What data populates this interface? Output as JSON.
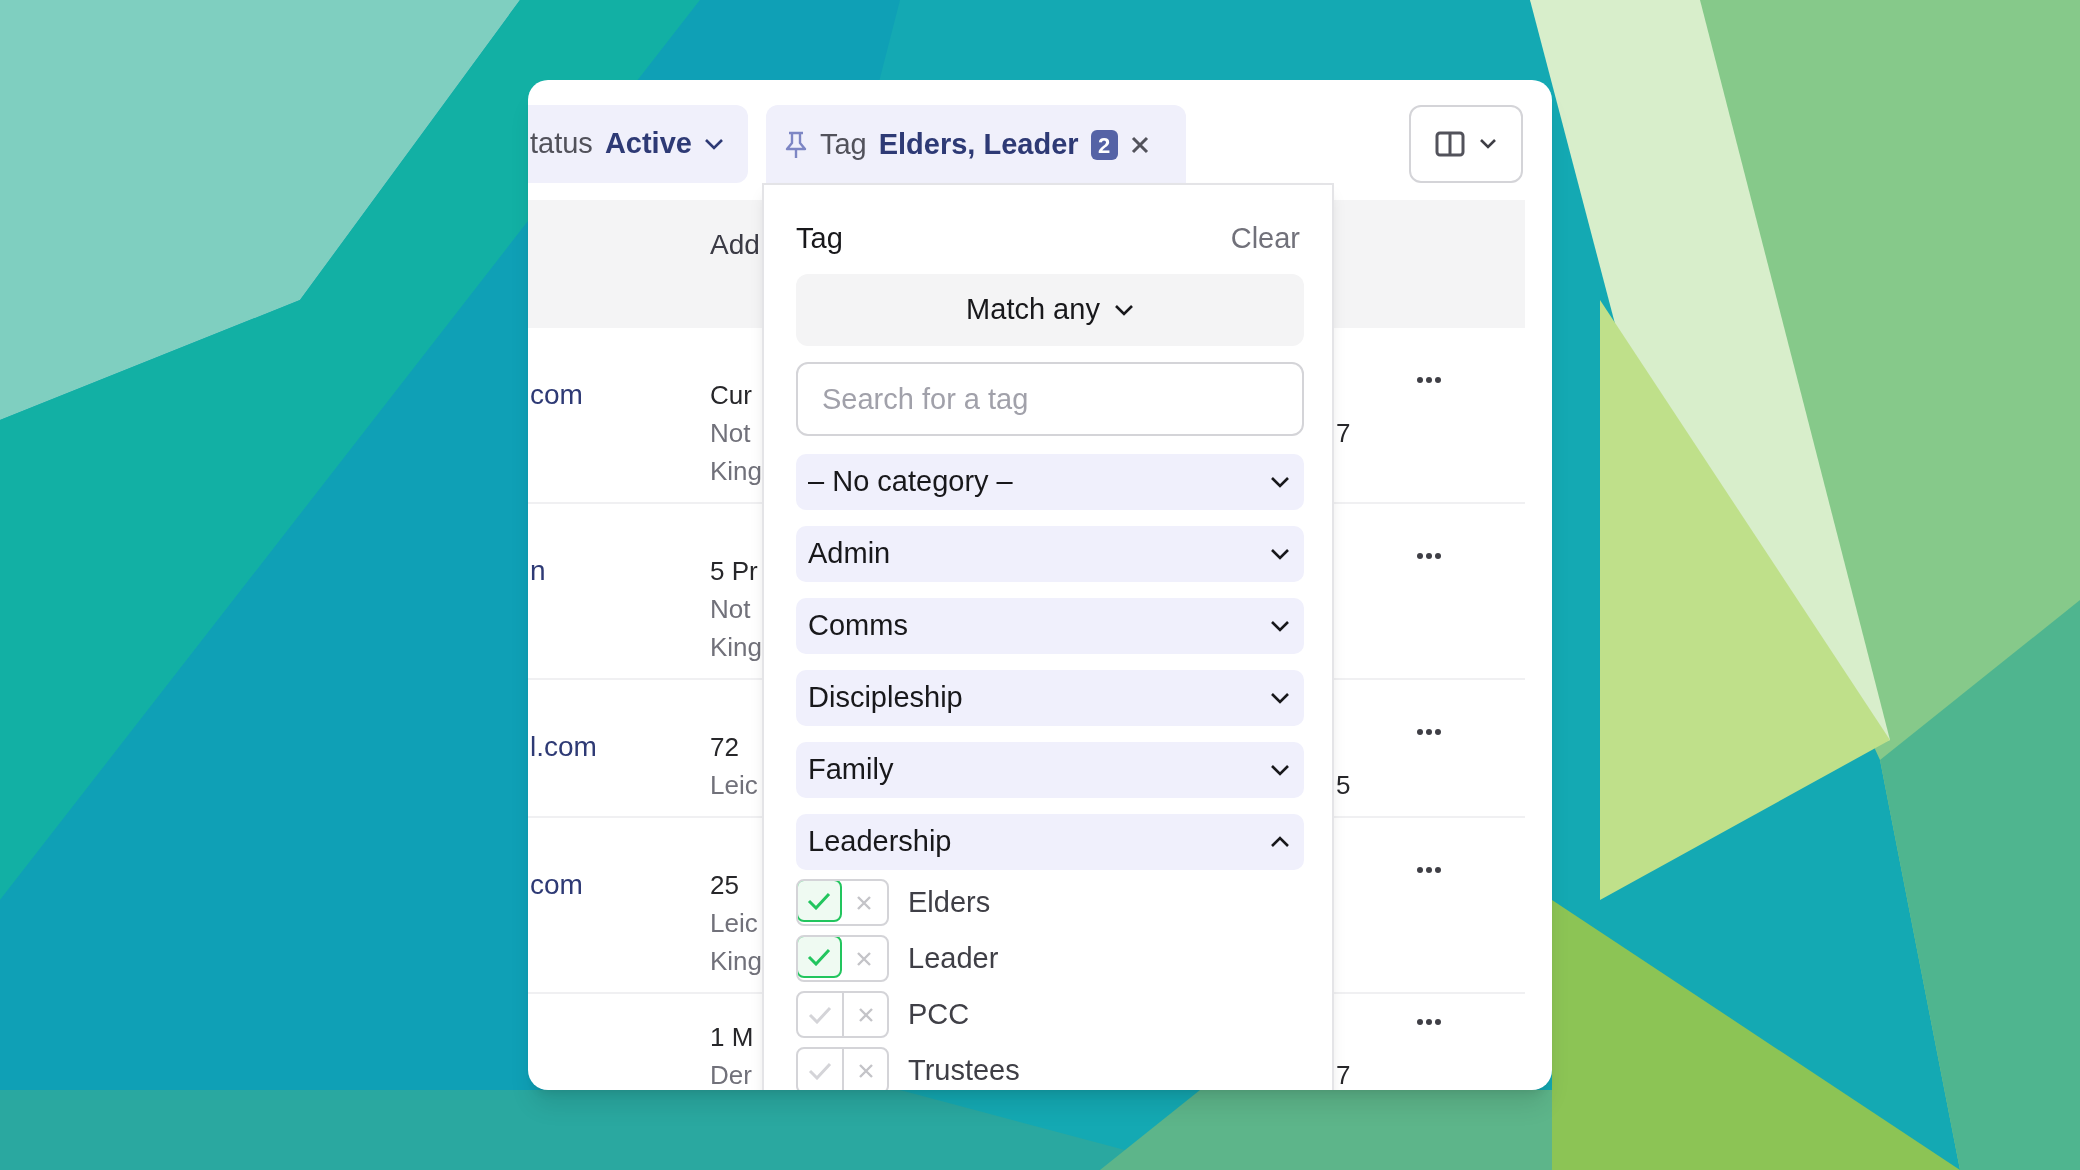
{
  "filters": [
    {
      "kind": "select",
      "label": "tatus",
      "value": "Active"
    },
    {
      "kind": "tag",
      "label": "Tag",
      "value": "Elders, Leader",
      "count": "2"
    }
  ],
  "table": {
    "header": "Add",
    "rows": [
      {
        "column_1": "com",
        "column_2": [
          "Cur",
          "Not",
          "King"
        ],
        "column_3": "7"
      },
      {
        "column_1": "n",
        "column_2": [
          "5 Pr",
          "Not",
          "King"
        ]
      },
      {
        "column_1": "l.com",
        "column_2": [
          "72",
          "Leic"
        ],
        "column_3": "5"
      },
      {
        "column_1": "com",
        "column_2": [
          "25",
          "Leic",
          "King"
        ]
      },
      {
        "column_2": [
          "1 M",
          "Der"
        ],
        "column_3": "7"
      }
    ]
  },
  "popover": {
    "title": "Tag",
    "clear": "Clear",
    "match": "Match any",
    "search": {
      "placeholder": "Search for a tag"
    },
    "categories": [
      {
        "name": "– No category –",
        "expanded": false
      },
      {
        "name": "Admin",
        "expanded": false
      },
      {
        "name": "Comms",
        "expanded": false
      },
      {
        "name": "Discipleship",
        "expanded": false
      },
      {
        "name": "Family",
        "expanded": false
      },
      {
        "name": "Leadership",
        "expanded": true,
        "tags": [
          {
            "name": "Elders",
            "included": true
          },
          {
            "name": "Leader",
            "included": true
          },
          {
            "name": "PCC",
            "included": false
          },
          {
            "name": "Trustees",
            "included": false
          }
        ]
      }
    ]
  }
}
